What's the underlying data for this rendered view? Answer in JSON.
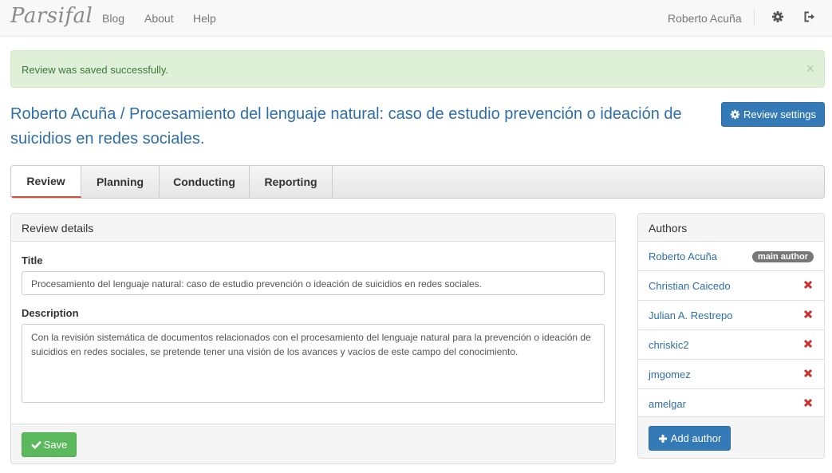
{
  "navbar": {
    "brand": "Parsifal",
    "links": [
      "Blog",
      "About",
      "Help"
    ],
    "user": "Roberto Acuña",
    "icons": [
      "gear-icon",
      "sign-out-icon"
    ]
  },
  "alert": {
    "message": "Review was saved successfully.",
    "close": "×"
  },
  "header": {
    "title": "Roberto Acuña / Procesamiento del lenguaje natural: caso de estudio prevención o ideación de suicidios en redes sociales.",
    "settings_button": "Review settings"
  },
  "tabs": [
    {
      "label": "Review",
      "active": true
    },
    {
      "label": "Planning",
      "active": false
    },
    {
      "label": "Conducting",
      "active": false
    },
    {
      "label": "Reporting",
      "active": false
    }
  ],
  "review_details": {
    "heading": "Review details",
    "title_label": "Title",
    "title_value": "Procesamiento del lenguaje natural: caso de estudio prevención o ideación de suicidios en redes sociales.",
    "description_label": "Description",
    "description_value": "Con la revisión sistemática de documentos relacionados con el procesamiento del lenguaje natural para la prevención o ideación de suicidios en redes sociales, se pretende tener una visión de los avances y vacíos de este campo del conocimiento.",
    "save_button": "Save"
  },
  "authors": {
    "heading": "Authors",
    "main_author_badge": "main author",
    "list": [
      {
        "name": "Roberto Acuña",
        "main": true
      },
      {
        "name": "Christian Caicedo",
        "main": false
      },
      {
        "name": "Julian A. Restrepo",
        "main": false
      },
      {
        "name": "chriskic2",
        "main": false
      },
      {
        "name": "jmgomez",
        "main": false
      },
      {
        "name": "amelgar",
        "main": false
      }
    ],
    "add_button": "Add author"
  },
  "colors": {
    "primary": "#337ab7",
    "success": "#5cb85c",
    "alert_bg": "#dff0d8",
    "alert_text": "#3c763d",
    "danger": "#c9302c",
    "tab_active_underline": "#c9563c"
  }
}
